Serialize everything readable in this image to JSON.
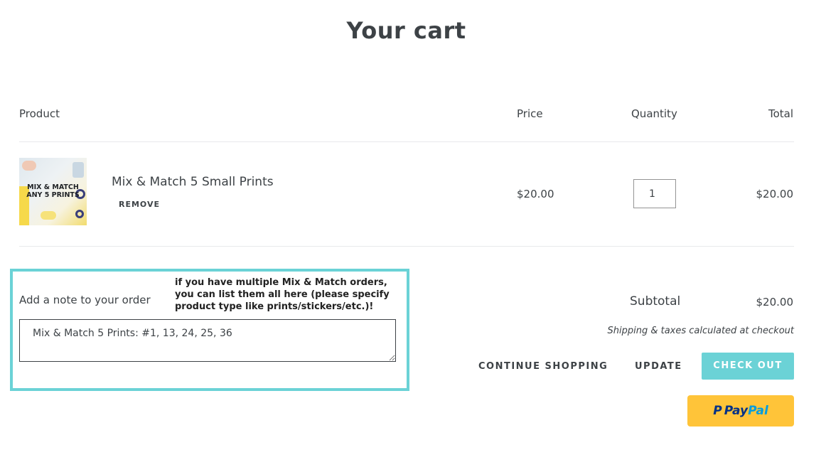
{
  "page": {
    "title": "Your cart"
  },
  "table": {
    "headers": {
      "product": "Product",
      "price": "Price",
      "quantity": "Quantity",
      "total": "Total"
    },
    "items": [
      {
        "thumbnail_text": [
          "MIX & MATCH",
          "ANY 5 PRINTS"
        ],
        "name": "Mix & Match 5 Small Prints",
        "remove_label": "REMOVE",
        "price": "$20.00",
        "quantity": "1",
        "total": "$20.00"
      }
    ]
  },
  "note": {
    "label": "Add a note to your order",
    "hint": "if you have multiple Mix & Match orders, you can list them all here (please specify product type like prints/stickers/etc.)!",
    "value": "Mix & Match 5 Prints: #1, 13, 24, 25, 36",
    "highlight_color": "#6bd2d6"
  },
  "summary": {
    "subtotal_label": "Subtotal",
    "subtotal_value": "$20.00",
    "shipping_note": "Shipping & taxes calculated at checkout"
  },
  "actions": {
    "continue_label": "CONTINUE SHOPPING",
    "update_label": "UPDATE",
    "checkout_label": "CHECK OUT",
    "checkout_color": "#6bd2d6",
    "paypal_text_1": "Pay",
    "paypal_text_2": "Pal",
    "paypal_color": "#ffc439",
    "paypal_icon": "paypal-icon"
  }
}
